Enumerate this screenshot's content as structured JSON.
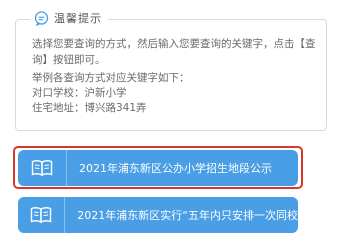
{
  "tips": {
    "title": "温馨提示",
    "line1": "选择您要查询的方式，然后输入您要查询的关键字，点击【查",
    "line2": "询】按钮即可。",
    "line3": "举例各查询方式对应关键字如下：",
    "line4": "对口学校：沪新小学",
    "line5": "住宅地址：博兴路341弄"
  },
  "links": [
    {
      "label": "2021年浦东新区公办小学招生地段公示",
      "icon": "book-icon"
    },
    {
      "label": "2021年浦东新区实行“五年内只安排一次同校",
      "icon": "book-icon"
    }
  ],
  "colors": {
    "button": "#4a9ee6",
    "highlight": "#d9372e",
    "tip_icon": "#4a9ee6"
  }
}
